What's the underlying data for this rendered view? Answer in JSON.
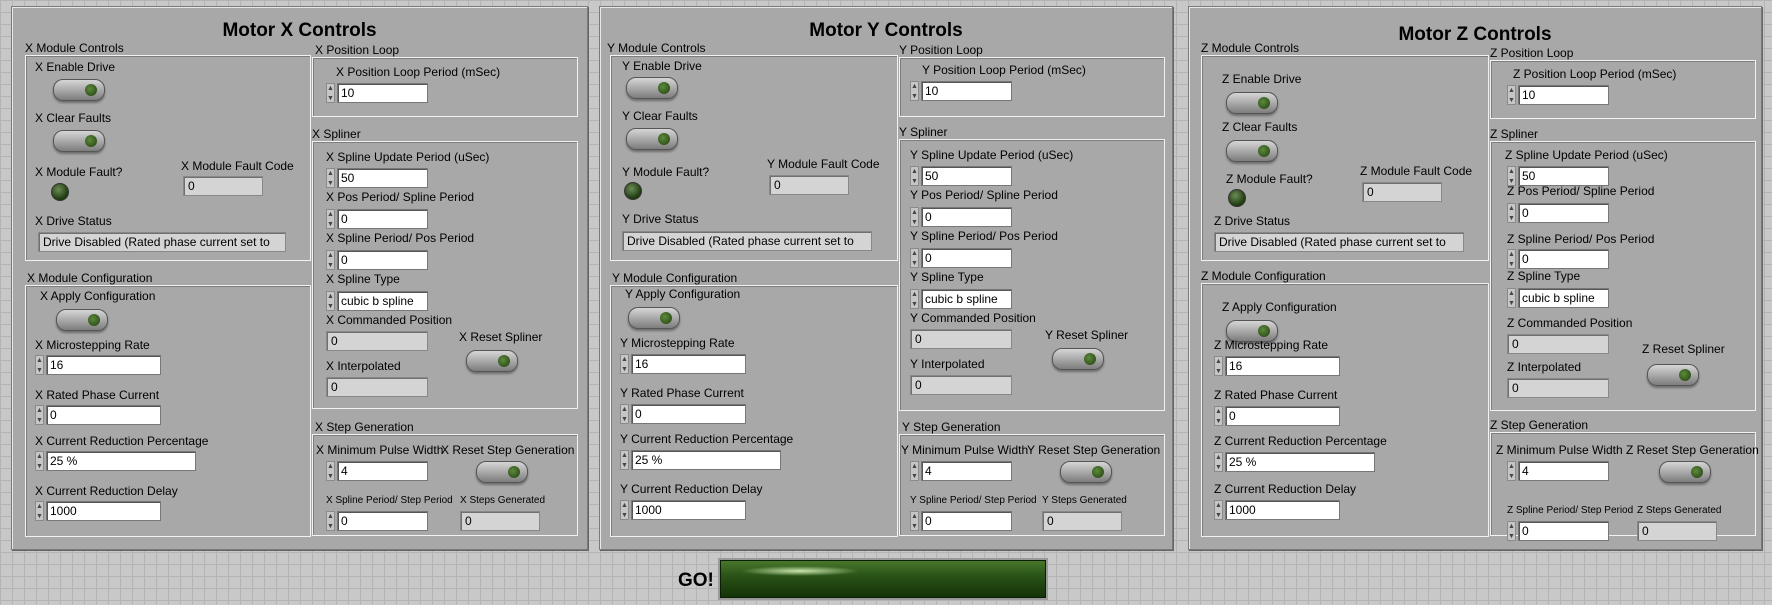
{
  "motors": [
    {
      "title": "Motor X Controls",
      "module_controls": "X Module Controls",
      "enable_drive": "X Enable Drive",
      "clear_faults": "X Clear Faults",
      "module_fault": "X Module Fault?",
      "fault_code_label": "X Module Fault Code",
      "fault_code_value": "0",
      "drive_status_label": "X Drive Status",
      "drive_status_value": "Drive Disabled (Rated phase current set to",
      "module_config": "X Module Configuration",
      "apply_config": "X Apply Configuration",
      "microstep_label": "X Microstepping Rate",
      "microstep_value": "16",
      "rated_current_label": "X Rated Phase Current",
      "rated_current_value": "0",
      "reduction_pct_label": "X Current Reduction Percentage",
      "reduction_pct_value": "25 %",
      "reduction_delay_label": "X Current Reduction Delay",
      "reduction_delay_value": "1000",
      "position_loop": "X Position Loop",
      "loop_period_label": "X Position Loop Period (mSec)",
      "loop_period_value": "10",
      "spliner": "X Spliner",
      "spline_update_label": "X Spline Update Period (uSec)",
      "spline_update_value": "50",
      "pos_spline_label": "X Pos Period/ Spline Period",
      "pos_spline_value": "0",
      "spline_pos_label": "X Spline Period/ Pos Period",
      "spline_pos_value": "0",
      "spline_type_label": "X Spline Type",
      "spline_type_value": "cubic b spline",
      "commanded_label": "X Commanded Position",
      "commanded_value": "0",
      "interpolated_label": "X Interpolated",
      "interpolated_value": "0",
      "reset_spliner": "X Reset Spliner",
      "step_gen": "X Step Generation",
      "min_pulse_label": "X Minimum Pulse Width",
      "min_pulse_value": "4",
      "reset_step_gen": "X Reset Step Generation",
      "spline_step_label": "X Spline Period/ Step Period",
      "spline_step_value": "0",
      "steps_gen_label": "X Steps Generated",
      "steps_gen_value": "0"
    },
    {
      "title": "Motor Y Controls",
      "module_controls": "Y Module Controls",
      "enable_drive": "Y Enable Drive",
      "clear_faults": "Y Clear Faults",
      "module_fault": "Y Module Fault?",
      "fault_code_label": "Y Module Fault Code",
      "fault_code_value": "0",
      "drive_status_label": "Y Drive Status",
      "drive_status_value": "Drive Disabled (Rated phase current set to",
      "module_config": "Y Module Configuration",
      "apply_config": "Y Apply Configuration",
      "microstep_label": "Y Microstepping Rate",
      "microstep_value": "16",
      "rated_current_label": "Y Rated Phase Current",
      "rated_current_value": "0",
      "reduction_pct_label": "Y Current Reduction Percentage",
      "reduction_pct_value": "25 %",
      "reduction_delay_label": "Y Current Reduction Delay",
      "reduction_delay_value": "1000",
      "position_loop": "Y Position Loop",
      "loop_period_label": "Y Position Loop Period (mSec)",
      "loop_period_value": "10",
      "spliner": "Y Spliner",
      "spline_update_label": "Y Spline Update Period (uSec)",
      "spline_update_value": "50",
      "pos_spline_label": "Y Pos Period/ Spline Period",
      "pos_spline_value": "0",
      "spline_pos_label": "Y Spline Period/ Pos Period",
      "spline_pos_value": "0",
      "spline_type_label": "Y Spline Type",
      "spline_type_value": "cubic b spline",
      "commanded_label": "Y Commanded Position",
      "commanded_value": "0",
      "interpolated_label": "Y Interpolated",
      "interpolated_value": "0",
      "reset_spliner": "Y Reset Spliner",
      "step_gen": "Y Step Generation",
      "min_pulse_label": "Y Minimum Pulse Width",
      "min_pulse_value": "4",
      "reset_step_gen": "Y Reset Step Generation",
      "spline_step_label": "Y Spline Period/ Step Period",
      "spline_step_value": "0",
      "steps_gen_label": "Y Steps Generated",
      "steps_gen_value": "0"
    },
    {
      "title": "Motor Z Controls",
      "module_controls": "Z Module Controls",
      "enable_drive": "Z Enable Drive",
      "clear_faults": "Z Clear Faults",
      "module_fault": "Z Module Fault?",
      "fault_code_label": "Z Module Fault Code",
      "fault_code_value": "0",
      "drive_status_label": "Z Drive Status",
      "drive_status_value": "Drive Disabled (Rated phase current set to",
      "module_config": "Z Module Configuration",
      "apply_config": "Z Apply Configuration",
      "microstep_label": "Z Microstepping Rate",
      "microstep_value": "16",
      "rated_current_label": "Z Rated Phase Current",
      "rated_current_value": "0",
      "reduction_pct_label": "Z Current Reduction Percentage",
      "reduction_pct_value": "25 %",
      "reduction_delay_label": "Z Current Reduction Delay",
      "reduction_delay_value": "1000",
      "position_loop": "Z Position Loop",
      "loop_period_label": "Z Position Loop Period (mSec)",
      "loop_period_value": "10",
      "spliner": "Z Spliner",
      "spline_update_label": "Z Spline Update Period (uSec)",
      "spline_update_value": "50",
      "pos_spline_label": "Z Pos Period/ Spline Period",
      "pos_spline_value": "0",
      "spline_pos_label": "Z Spline Period/ Pos Period",
      "spline_pos_value": "0",
      "spline_type_label": "Z Spline Type",
      "spline_type_value": "cubic b spline",
      "commanded_label": "Z Commanded Position",
      "commanded_value": "0",
      "interpolated_label": "Z Interpolated",
      "interpolated_value": "0",
      "reset_spliner": "Z Reset Spliner",
      "step_gen": "Z Step Generation",
      "min_pulse_label": "Z Minimum Pulse Width",
      "min_pulse_value": "4",
      "reset_step_gen": "Z Reset Step Generation",
      "spline_step_label": "Z Spline Period/ Step Period",
      "spline_step_value": "0",
      "steps_gen_label": "Z Steps Generated",
      "steps_gen_value": "0"
    }
  ],
  "go": {
    "label": "GO!"
  }
}
